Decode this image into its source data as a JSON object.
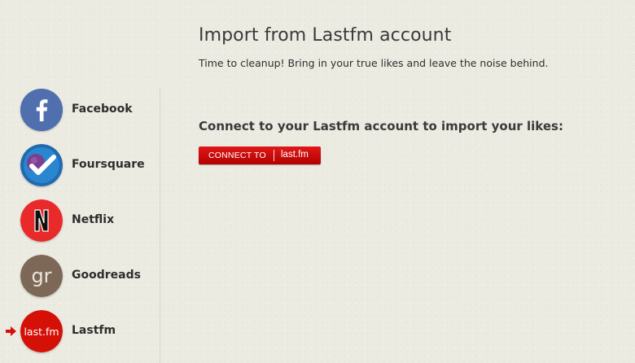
{
  "page": {
    "title": "Import from Lastfm account",
    "subtitle": "Time to cleanup! Bring in your true likes and leave the noise behind."
  },
  "sidebar": {
    "items": [
      {
        "label": "Facebook",
        "icon": "facebook-icon",
        "color": "#3b5998"
      },
      {
        "label": "Foursquare",
        "icon": "foursquare-icon",
        "color": "#1a6fb5"
      },
      {
        "label": "Netflix",
        "icon": "netflix-icon",
        "color": "#e82323"
      },
      {
        "label": "Goodreads",
        "icon": "goodreads-icon",
        "color": "#7a6455"
      },
      {
        "label": "Lastfm",
        "icon": "lastfm-icon",
        "color": "#d51007",
        "active": true
      }
    ]
  },
  "connect": {
    "heading": "Connect to your Lastfm account to import your likes:",
    "button_left": "CONNECT TO",
    "button_right": "last.fm",
    "button_color": "#d10a0a"
  },
  "active_indicator_icon": "arrow-right-icon"
}
